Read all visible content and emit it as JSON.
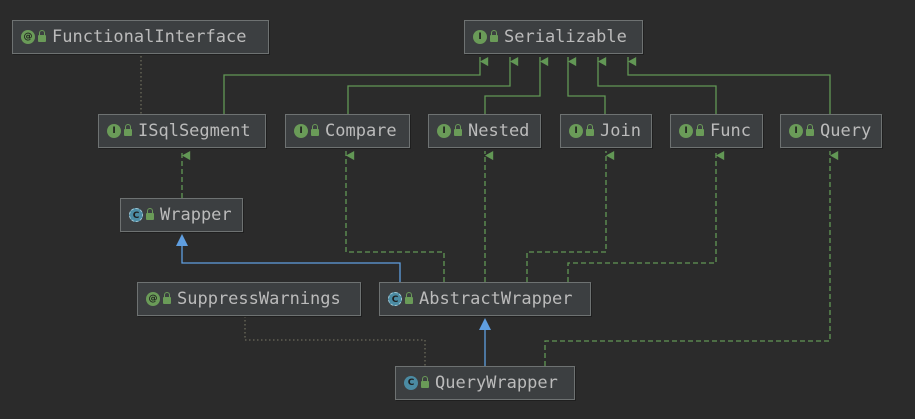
{
  "nodes": {
    "functional_interface": {
      "label": "FunctionalInterface",
      "kind": "annotation",
      "icon_text": "@"
    },
    "serializable": {
      "label": "Serializable",
      "kind": "interface",
      "icon_text": "I"
    },
    "isqlsegment": {
      "label": "ISqlSegment",
      "kind": "interface",
      "icon_text": "I"
    },
    "compare": {
      "label": "Compare",
      "kind": "interface",
      "icon_text": "I"
    },
    "nested": {
      "label": "Nested",
      "kind": "interface",
      "icon_text": "I"
    },
    "join": {
      "label": "Join",
      "kind": "interface",
      "icon_text": "I"
    },
    "func": {
      "label": "Func",
      "kind": "interface",
      "icon_text": "I"
    },
    "query": {
      "label": "Query",
      "kind": "interface",
      "icon_text": "I"
    },
    "wrapper": {
      "label": "Wrapper",
      "kind": "abstract-class",
      "icon_text": "C"
    },
    "suppress_warnings": {
      "label": "SuppressWarnings",
      "kind": "annotation",
      "icon_text": "@"
    },
    "abstract_wrapper": {
      "label": "AbstractWrapper",
      "kind": "abstract-class",
      "icon_text": "C"
    },
    "query_wrapper": {
      "label": "QueryWrapper",
      "kind": "class",
      "icon_text": "C"
    }
  },
  "colors": {
    "background": "#2b2b2b",
    "node_fill": "#3c3f41",
    "node_border": "#6e7272",
    "text": "#bbbbbb",
    "interface_edge": "#629755",
    "extends_edge": "#5f9ee0",
    "annotation_edge": "#6b6a5b"
  }
}
